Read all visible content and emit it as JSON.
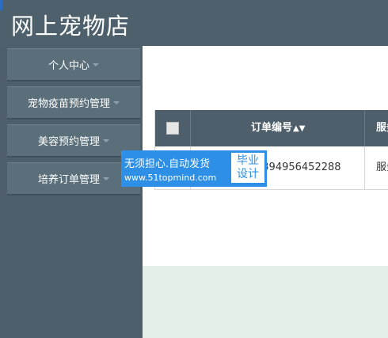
{
  "header": {
    "title": "网上宠物店"
  },
  "sidebar": {
    "items": [
      {
        "label": "个人中心"
      },
      {
        "label": "宠物疫苗预约管理"
      },
      {
        "label": "美容预约管理"
      },
      {
        "label": "培养订单管理"
      }
    ]
  },
  "table": {
    "headers": {
      "order_no": "订单编号",
      "service": "服务"
    },
    "rows": [
      {
        "order_no": "1394956452288",
        "service": "服务"
      }
    ]
  },
  "watermark": {
    "line1": "无须担心.自动发货",
    "line2": "www.51topmind.com",
    "badge_line1": "毕业",
    "badge_line2": "设计"
  }
}
